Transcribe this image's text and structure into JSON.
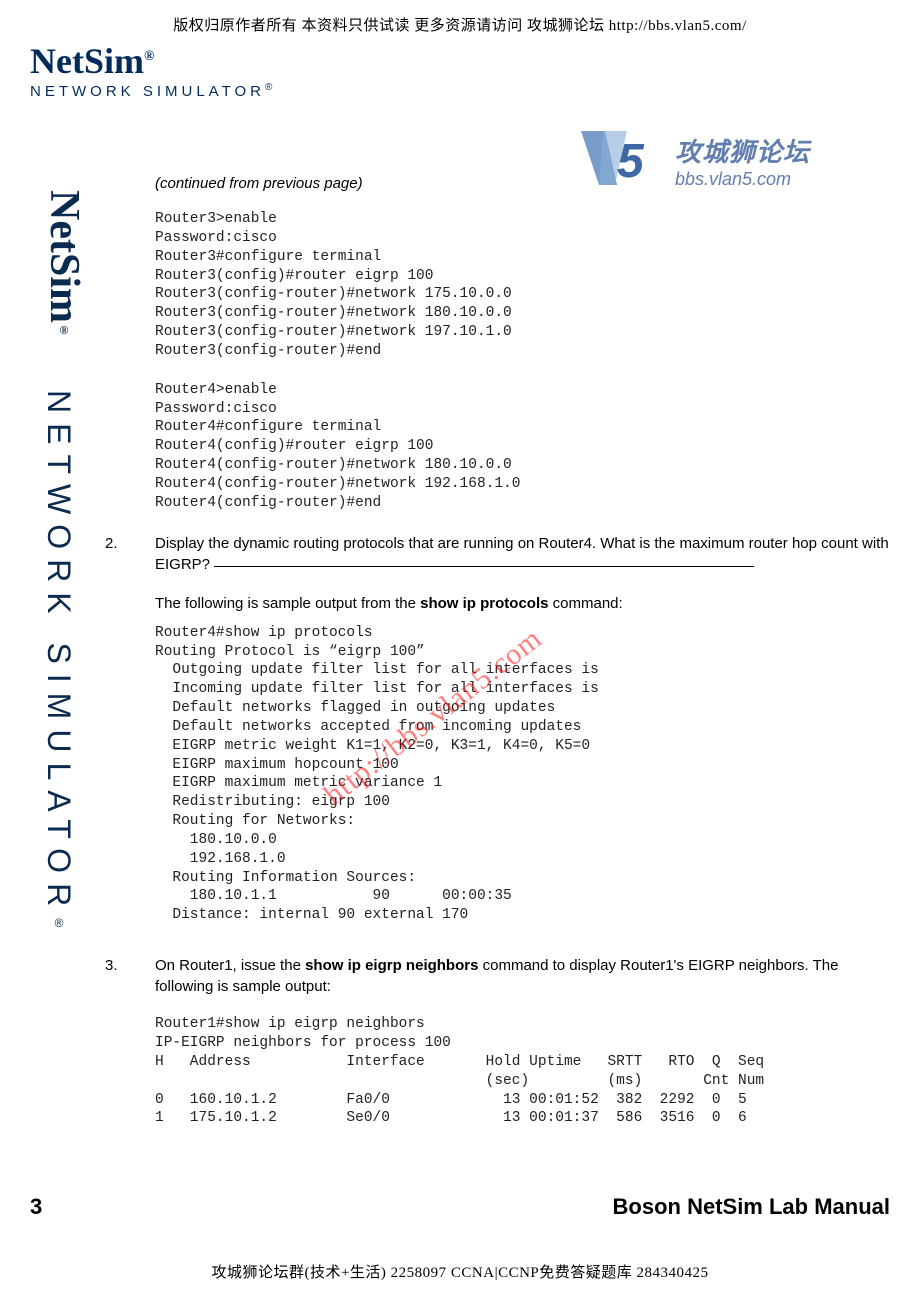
{
  "banners": {
    "top": "版权归原作者所有 本资料只供试读 更多资源请访问 攻城狮论坛 http://bbs.vlan5.com/",
    "bottom": "攻城狮论坛群(技术+生活) 2258097 CCNA|CCNP免费答疑题库 284340425"
  },
  "logo": {
    "name": "NetSim",
    "tagline": "NETWORK SIMULATOR",
    "reg": "®"
  },
  "side": {
    "bold": "NetSim",
    "light": "NETWORK SIMULATOR",
    "reg": "®"
  },
  "watermark": {
    "title": "攻城狮论坛",
    "url": "bbs.vlan5.com"
  },
  "diag_watermark": "http://bbs.vlan5.com",
  "body": {
    "continued": "(continued from previous page)",
    "term1": "Router3>enable\nPassword:cisco\nRouter3#configure terminal\nRouter3(config)#router eigrp 100\nRouter3(config-router)#network 175.10.0.0\nRouter3(config-router)#network 180.10.0.0\nRouter3(config-router)#network 197.10.1.0\nRouter3(config-router)#end",
    "term2": "Router4>enable\nPassword:cisco\nRouter4#configure terminal\nRouter4(config)#router eigrp 100\nRouter4(config-router)#network 180.10.0.0\nRouter4(config-router)#network 192.168.1.0\nRouter4(config-router)#end",
    "step2_num": "2.",
    "step2_text_a": "Display the dynamic routing protocols that are running on Router4. What is the maximum router hop count with EIGRP?   ",
    "step2_followup_a": "The following is sample output from the ",
    "step2_followup_cmd": "show ip protocols",
    "step2_followup_b": " command:",
    "term3": "Router4#show ip protocols\nRouting Protocol is “eigrp 100”\n  Outgoing update filter list for all interfaces is\n  Incoming update filter list for all interfaces is\n  Default networks flagged in outgoing updates\n  Default networks accepted from incoming updates\n  EIGRP metric weight K1=1, K2=0, K3=1, K4=0, K5=0\n  EIGRP maximum hopcount 100\n  EIGRP maximum metric variance 1\n  Redistributing: eigrp 100\n  Routing for Networks:\n    180.10.0.0\n    192.168.1.0\n  Routing Information Sources:\n    180.10.1.1           90      00:00:35\n  Distance: internal 90 external 170",
    "step3_num": "3.",
    "step3_text_a": "On Router1, issue the ",
    "step3_cmd": "show ip eigrp neighbors",
    "step3_text_b": " command to display Router1's EIGRP neighbors. The following is sample output:",
    "term4": "Router1#show ip eigrp neighbors\nIP-EIGRP neighbors for process 100\nH   Address           Interface       Hold Uptime   SRTT   RTO  Q  Seq\n                                      (sec)         (ms)       Cnt Num\n0   160.10.1.2        Fa0/0             13 00:01:52  382  2292  0  5\n1   175.10.1.2        Se0/0             13 00:01:37  586  3516  0  6"
  },
  "footer": {
    "page": "3",
    "title": "Boson NetSim Lab Manual"
  }
}
